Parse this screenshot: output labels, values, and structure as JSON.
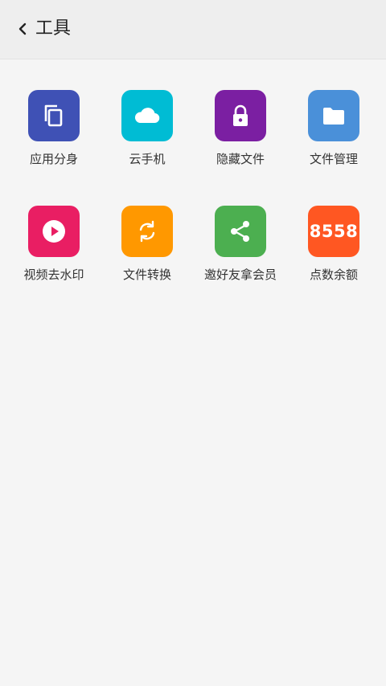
{
  "header": {
    "title": "工具",
    "back_icon": "chevron-left-icon"
  },
  "tools": [
    {
      "label": "应用分身",
      "icon": "copy-icon",
      "color": "#3f51b5"
    },
    {
      "label": "云手机",
      "icon": "cloud-icon",
      "color": "#00bcd4"
    },
    {
      "label": "隐藏文件",
      "icon": "lock-icon",
      "color": "#7b1fa2"
    },
    {
      "label": "文件管理",
      "icon": "folder-icon",
      "color": "#4a90d9"
    },
    {
      "label": "视频去水印",
      "icon": "play-icon",
      "color": "#e91e63"
    },
    {
      "label": "文件转换",
      "icon": "sync-icon",
      "color": "#ff9800"
    },
    {
      "label": "邀好友拿会员",
      "icon": "share-icon",
      "color": "#4caf50"
    },
    {
      "label": "点数余额",
      "icon": "points-balance-icon",
      "color": "#ff5722",
      "badge": "8558"
    }
  ]
}
